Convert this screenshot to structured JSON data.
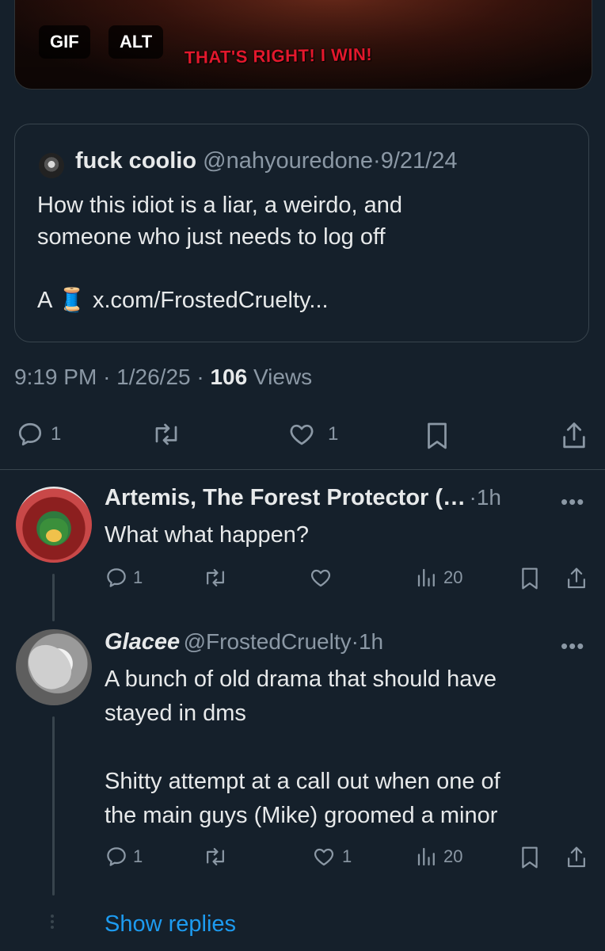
{
  "media": {
    "gif_badge": "GIF",
    "alt_badge": "ALT",
    "caption": "THAT'S RIGHT! I WIN!"
  },
  "quoted_post": {
    "display_name": "fuck coolio",
    "handle": "@nahyouredone",
    "date": "9/21/24",
    "separator": "·",
    "text_line1": "How this idiot is a liar, a weirdo, and",
    "text_line2": "someone who just needs to log off",
    "text_line3_prefix": "A",
    "text_line3_emoji": "🧵",
    "text_line3_link": "x.com/FrostedCruelty..."
  },
  "post_meta": {
    "time": "9:19 PM",
    "date": "1/26/25",
    "views_count": "106",
    "views_label": "Views",
    "separator": "·"
  },
  "post_actions": {
    "reply_count": "1",
    "like_count": "1"
  },
  "replies": [
    {
      "display_name": "Artemis, The Forest Protector (…",
      "time": "1h",
      "text": "What what happen?",
      "reply_count": "1",
      "views_count": "20",
      "more": "•••"
    },
    {
      "display_name": "Glacee",
      "handle": "@FrostedCruelty",
      "time": "1h",
      "text_line1": "A bunch of old drama that should have",
      "text_line2": "stayed in dms",
      "text_line3": "Shitty attempt at a call out when one of",
      "text_line4": "the main guys (Mike) groomed a minor",
      "reply_count": "1",
      "like_count": "1",
      "views_count": "20",
      "more": "•••"
    }
  ],
  "show_replies": "Show replies",
  "colors": {
    "background": "#15202b",
    "text": "#e7e9ea",
    "muted": "#8b98a5",
    "accent": "#1d9bf0",
    "border": "#38444d"
  }
}
